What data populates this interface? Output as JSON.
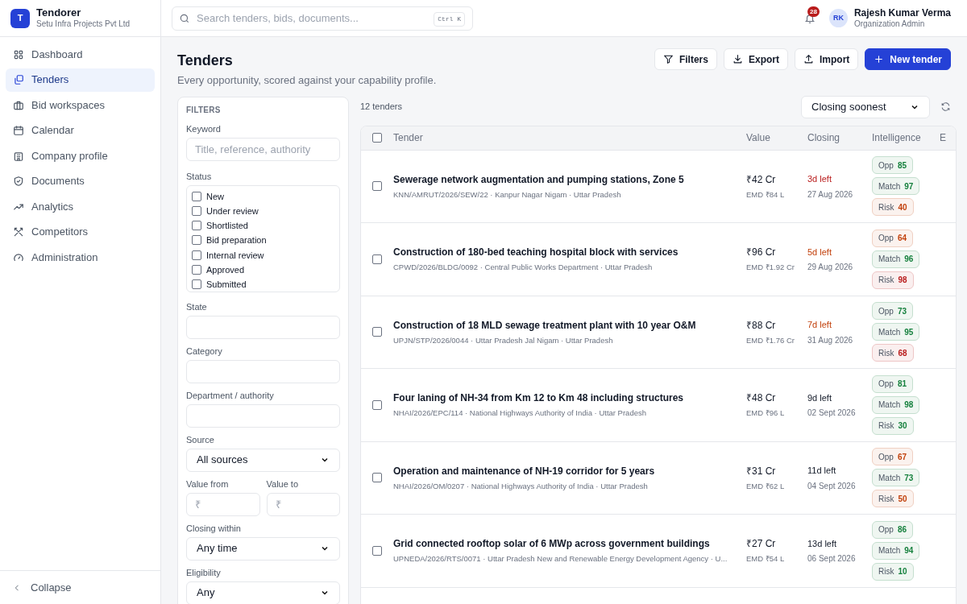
{
  "brand": {
    "initial": "T",
    "name": "Tendorer",
    "org": "Setu Infra Projects Pvt Ltd"
  },
  "search": {
    "placeholder": "Search tenders, bids, documents...",
    "shortcut": "Ctrl K"
  },
  "notifications": {
    "count": "28"
  },
  "user": {
    "initials": "RK",
    "name": "Rajesh Kumar Verma",
    "role": "Organization Admin"
  },
  "sidebar": {
    "items": [
      {
        "label": "Dashboard",
        "selected": false
      },
      {
        "label": "Tenders",
        "selected": true
      },
      {
        "label": "Bid workspaces",
        "selected": false
      },
      {
        "label": "Calendar",
        "selected": false
      },
      {
        "label": "Company profile",
        "selected": false
      },
      {
        "label": "Documents",
        "selected": false
      },
      {
        "label": "Analytics",
        "selected": false
      },
      {
        "label": "Competitors",
        "selected": false
      },
      {
        "label": "Administration",
        "selected": false
      }
    ],
    "collapse": "Collapse"
  },
  "page": {
    "title": "Tenders",
    "subtitle": "Every opportunity, scored against your capability profile."
  },
  "actions": [
    {
      "label": "Filters",
      "kind": "outline"
    },
    {
      "label": "Export",
      "kind": "outline"
    },
    {
      "label": "Import",
      "kind": "outline"
    },
    {
      "label": "New tender",
      "kind": "primary"
    }
  ],
  "filters": {
    "heading": "FILTERS",
    "keyword": {
      "label": "Keyword",
      "placeholder": "Title, reference, authority"
    },
    "status": {
      "label": "Status",
      "options": [
        {
          "label": "New",
          "checked": false
        },
        {
          "label": "Under review",
          "checked": false
        },
        {
          "label": "Shortlisted",
          "checked": false
        },
        {
          "label": "Bid preparation",
          "checked": false
        },
        {
          "label": "Internal review",
          "checked": false
        },
        {
          "label": "Approved",
          "checked": false
        },
        {
          "label": "Submitted",
          "checked": false
        }
      ]
    },
    "state": {
      "label": "State"
    },
    "category": {
      "label": "Category"
    },
    "department": {
      "label": "Department / authority"
    },
    "source": {
      "label": "Source",
      "value": "All sources"
    },
    "value_from": {
      "label": "Value from",
      "placeholder": "₹"
    },
    "value_to": {
      "label": "Value to",
      "placeholder": "₹"
    },
    "closing_within": {
      "label": "Closing within",
      "value": "Any time"
    },
    "eligibility": {
      "label": "Eligibility",
      "value": "Any"
    }
  },
  "results": {
    "count": "12 tenders",
    "sort": "Closing soonest"
  },
  "table": {
    "all_selected": false,
    "columns": [
      "Tender",
      "Value",
      "Closing",
      "Intelligence",
      "E"
    ],
    "rows": [
      {
        "selected": false,
        "title": "Sewerage network augmentation and pumping stations, Zone 5",
        "meta": "KNN/AMRUT/2026/SEW/22 · Kanpur Nagar Nigam · Uttar Pradesh",
        "value": "₹42 Cr",
        "emd": "EMD ₹84 L",
        "closing": {
          "left": "3d left",
          "color": "#b91c1c",
          "date": "27 Aug 2026"
        },
        "scores": [
          {
            "label": "Opp",
            "value": "85",
            "color": "#15803d"
          },
          {
            "label": "Match",
            "value": "97",
            "color": "#15803d"
          },
          {
            "label": "Risk",
            "value": "40",
            "color": "#c2410c"
          }
        ]
      },
      {
        "selected": false,
        "title": "Construction of 180-bed teaching hospital block with services",
        "meta": "CPWD/2026/BLDG/0092 · Central Public Works Department · Uttar Pradesh",
        "value": "₹96 Cr",
        "emd": "EMD ₹1.92 Cr",
        "closing": {
          "left": "5d left",
          "color": "#c2410c",
          "date": "29 Aug 2026"
        },
        "scores": [
          {
            "label": "Opp",
            "value": "64",
            "color": "#c2410c"
          },
          {
            "label": "Match",
            "value": "96",
            "color": "#15803d"
          },
          {
            "label": "Risk",
            "value": "98",
            "color": "#b91c1c"
          }
        ]
      },
      {
        "selected": false,
        "title": "Construction of 18 MLD sewage treatment plant with 10 year O&M",
        "meta": "UPJN/STP/2026/0044 · Uttar Pradesh Jal Nigam · Uttar Pradesh",
        "value": "₹88 Cr",
        "emd": "EMD ₹1.76 Cr",
        "closing": {
          "left": "7d left",
          "color": "#c2410c",
          "date": "31 Aug 2026"
        },
        "scores": [
          {
            "label": "Opp",
            "value": "73",
            "color": "#15803d"
          },
          {
            "label": "Match",
            "value": "95",
            "color": "#15803d"
          },
          {
            "label": "Risk",
            "value": "68",
            "color": "#b91c1c"
          }
        ]
      },
      {
        "selected": false,
        "title": "Four laning of NH-34 from Km 12 to Km 48 including structures",
        "meta": "NHAI/2026/EPC/114 · National Highways Authority of India · Uttar Pradesh",
        "value": "₹48 Cr",
        "emd": "EMD ₹96 L",
        "closing": {
          "left": "9d left",
          "color": "#111827",
          "date": "02 Sept 2026"
        },
        "scores": [
          {
            "label": "Opp",
            "value": "81",
            "color": "#15803d"
          },
          {
            "label": "Match",
            "value": "98",
            "color": "#15803d"
          },
          {
            "label": "Risk",
            "value": "30",
            "color": "#15803d"
          }
        ]
      },
      {
        "selected": false,
        "title": "Operation and maintenance of NH-19 corridor for 5 years",
        "meta": "NHAI/2026/OM/0207 · National Highways Authority of India · Uttar Pradesh",
        "value": "₹31 Cr",
        "emd": "EMD ₹62 L",
        "closing": {
          "left": "11d left",
          "color": "#111827",
          "date": "04 Sept 2026"
        },
        "scores": [
          {
            "label": "Opp",
            "value": "67",
            "color": "#c2410c"
          },
          {
            "label": "Match",
            "value": "73",
            "color": "#15803d"
          },
          {
            "label": "Risk",
            "value": "50",
            "color": "#c2410c"
          }
        ]
      },
      {
        "selected": false,
        "title": "Grid connected rooftop solar of 6 MWp across government buildings",
        "meta": "UPNEDA/2026/RTS/0071 · Uttar Pradesh New and Renewable Energy Development Agency · U...",
        "value": "₹27 Cr",
        "emd": "EMD ₹54 L",
        "closing": {
          "left": "13d left",
          "color": "#111827",
          "date": "06 Sept 2026"
        },
        "scores": [
          {
            "label": "Opp",
            "value": "86",
            "color": "#15803d"
          },
          {
            "label": "Match",
            "value": "94",
            "color": "#15803d"
          },
          {
            "label": "Risk",
            "value": "10",
            "color": "#15803d"
          }
        ]
      }
    ]
  }
}
